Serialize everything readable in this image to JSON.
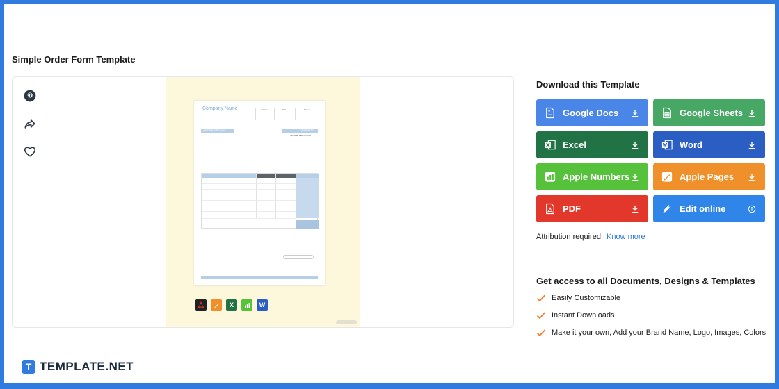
{
  "page_title": "Simple Order Form Template",
  "preview": {
    "document": {
      "company_name": "Company Name",
      "header_labels": [
        "Address",
        "Web",
        "Phone"
      ],
      "order_details": "ORDER DETAILS",
      "order_to": "ORDER TO",
      "order_to_name": "Template Labs Pvt Ltd"
    }
  },
  "download": {
    "title": "Download this Template",
    "buttons": [
      {
        "label": "Google Docs",
        "color": "#4a86e8",
        "icon": "google-docs-icon"
      },
      {
        "label": "Google Sheets",
        "color": "#47a765",
        "icon": "google-sheets-icon"
      },
      {
        "label": "Excel",
        "color": "#217346",
        "icon": "excel-icon"
      },
      {
        "label": "Word",
        "color": "#2b5ec2",
        "icon": "word-icon"
      },
      {
        "label": "Apple Numbers",
        "color": "#56c13b",
        "icon": "apple-numbers-icon"
      },
      {
        "label": "Apple Pages",
        "color": "#f0902b",
        "icon": "apple-pages-icon"
      },
      {
        "label": "PDF",
        "color": "#e2372b",
        "icon": "pdf-icon"
      },
      {
        "label": "Edit online",
        "color": "#2f86e8",
        "icon": "edit-pencil-icon"
      }
    ]
  },
  "attribution": {
    "text": "Attribution required",
    "link": "Know more"
  },
  "access": {
    "title": "Get access to all Documents, Designs & Templates",
    "features": [
      "Easily Customizable",
      "Instant Downloads",
      "Make it your own, Add your Brand Name, Logo, Images, Colors"
    ]
  },
  "logo": {
    "text": "TEMPLATE.NET"
  }
}
